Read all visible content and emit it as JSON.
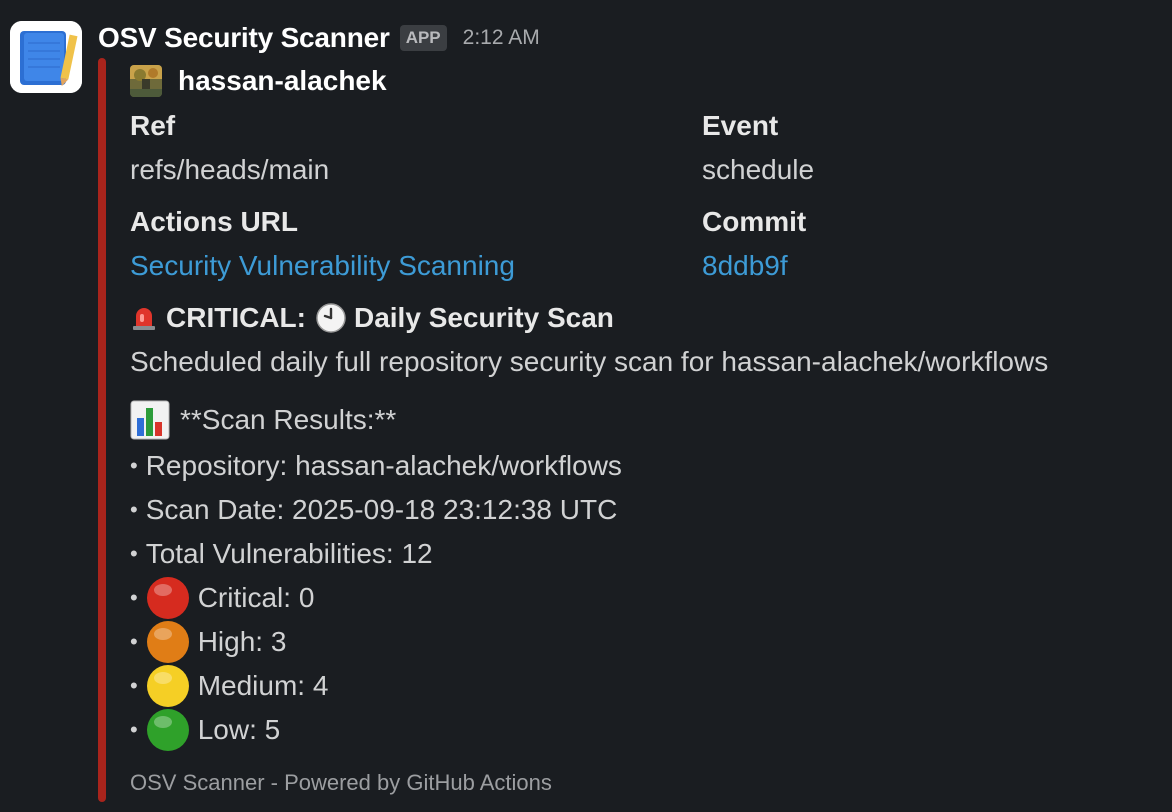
{
  "app": {
    "name": "OSV Security Scanner",
    "badge": "APP",
    "time": "2:12 AM",
    "icon": "notebook-pencil-icon"
  },
  "attachment": {
    "accent_color": "#a8241c",
    "author": "hassan-alachek",
    "fields": {
      "ref_title": "Ref",
      "ref_value": "refs/heads/main",
      "event_title": "Event",
      "event_value": "schedule",
      "actions_title": "Actions URL",
      "actions_value": "Security Vulnerability Scanning",
      "commit_title": "Commit",
      "commit_value": "8ddb9f"
    },
    "headline": {
      "prefix": "CRITICAL:",
      "title": "Daily Security Scan",
      "prefix_icon": "rotating-light-icon",
      "title_icon": "clock-icon"
    },
    "description": "Scheduled daily full repository security scan for hassan-alachek/workflows",
    "results_heading": "**Scan Results:**",
    "results": [
      {
        "text": "Repository: hassan-alachek/workflows"
      },
      {
        "text": "Scan Date: 2025-09-18 23:12:38 UTC"
      },
      {
        "text": "Total Vulnerabilities: 12"
      },
      {
        "text": "Critical: 0",
        "icon": "red-circle-icon",
        "color": "#d62b1f"
      },
      {
        "text": "High: 3",
        "icon": "orange-circle-icon",
        "color": "#e07d16"
      },
      {
        "text": "Medium: 4",
        "icon": "yellow-circle-icon",
        "color": "#f5cf25"
      },
      {
        "text": "Low: 5",
        "icon": "green-circle-icon",
        "color": "#2fa12a"
      }
    ],
    "bullet": "•",
    "footer": "OSV Scanner - Powered by GitHub Actions"
  }
}
